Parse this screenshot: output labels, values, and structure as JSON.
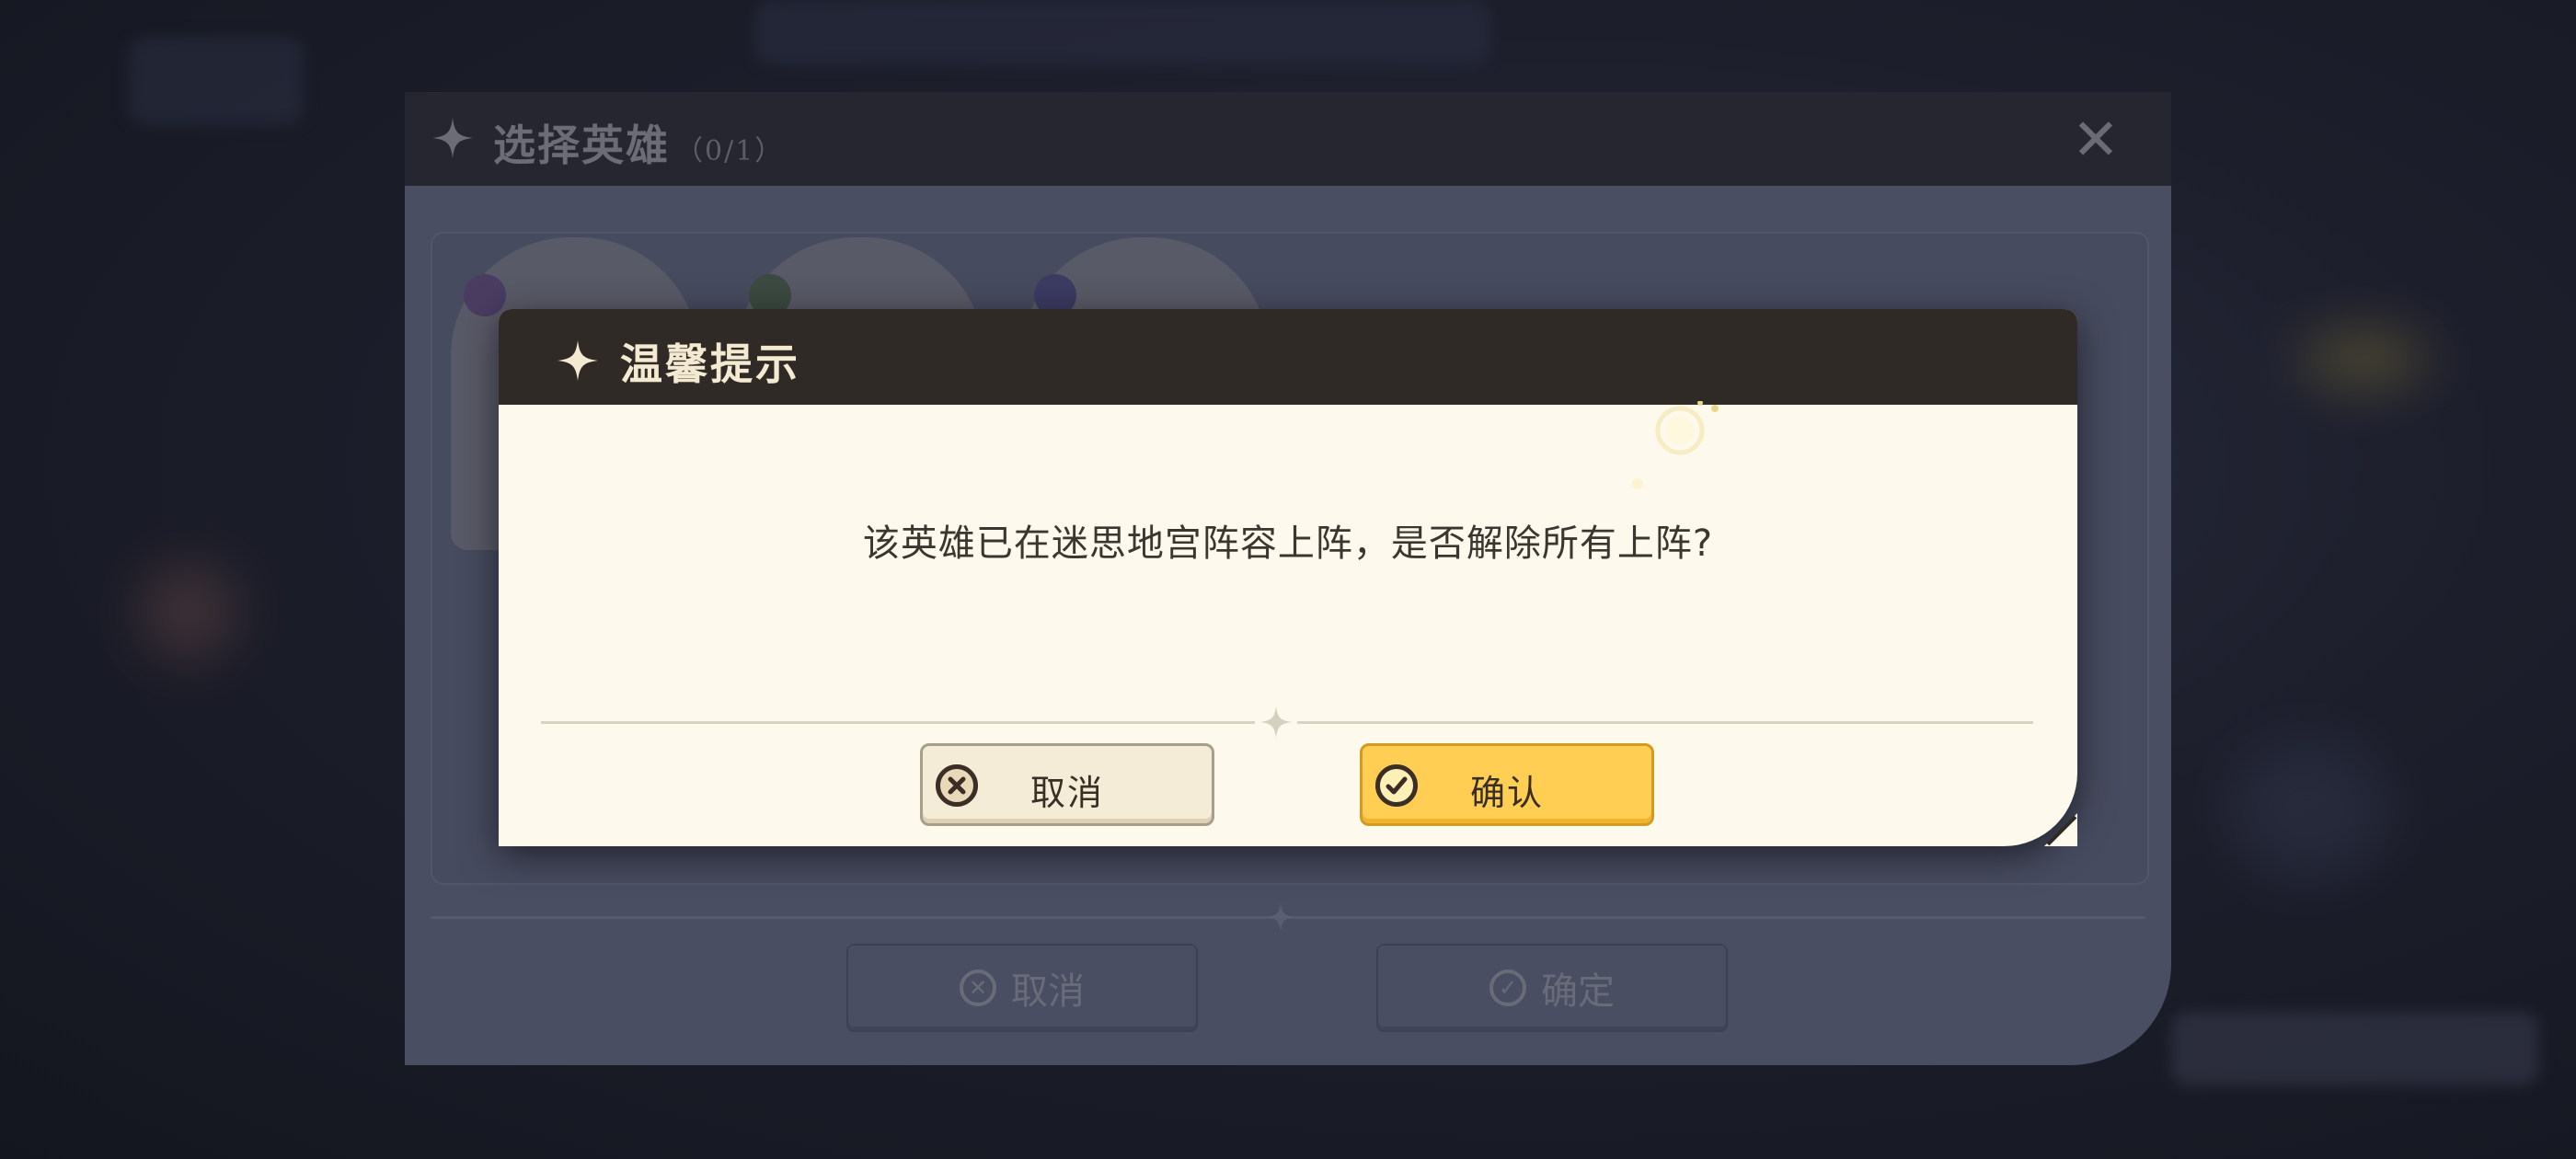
{
  "background_dialog": {
    "title": "选择英雄",
    "count": "（0/1）",
    "close_glyph": "✕",
    "cancel_label": "取消",
    "confirm_label": "确定"
  },
  "modal": {
    "title": "温馨提示",
    "message": "该英雄已在迷思地宫阵容上阵，是否解除所有上阵?",
    "cancel_label": "取消",
    "confirm_label": "确认"
  },
  "icons": {
    "header_star": "four-point-star-icon",
    "cancel": "cancel-x-circle-icon",
    "confirm": "checkmark-circle-icon",
    "close": "close-icon"
  },
  "colors": {
    "modal_header": "#302a26",
    "modal_body": "#fdf9ec",
    "confirm_button": "#ffce52",
    "cancel_button": "#f5ecd7",
    "overlay": "#4a4e63"
  }
}
